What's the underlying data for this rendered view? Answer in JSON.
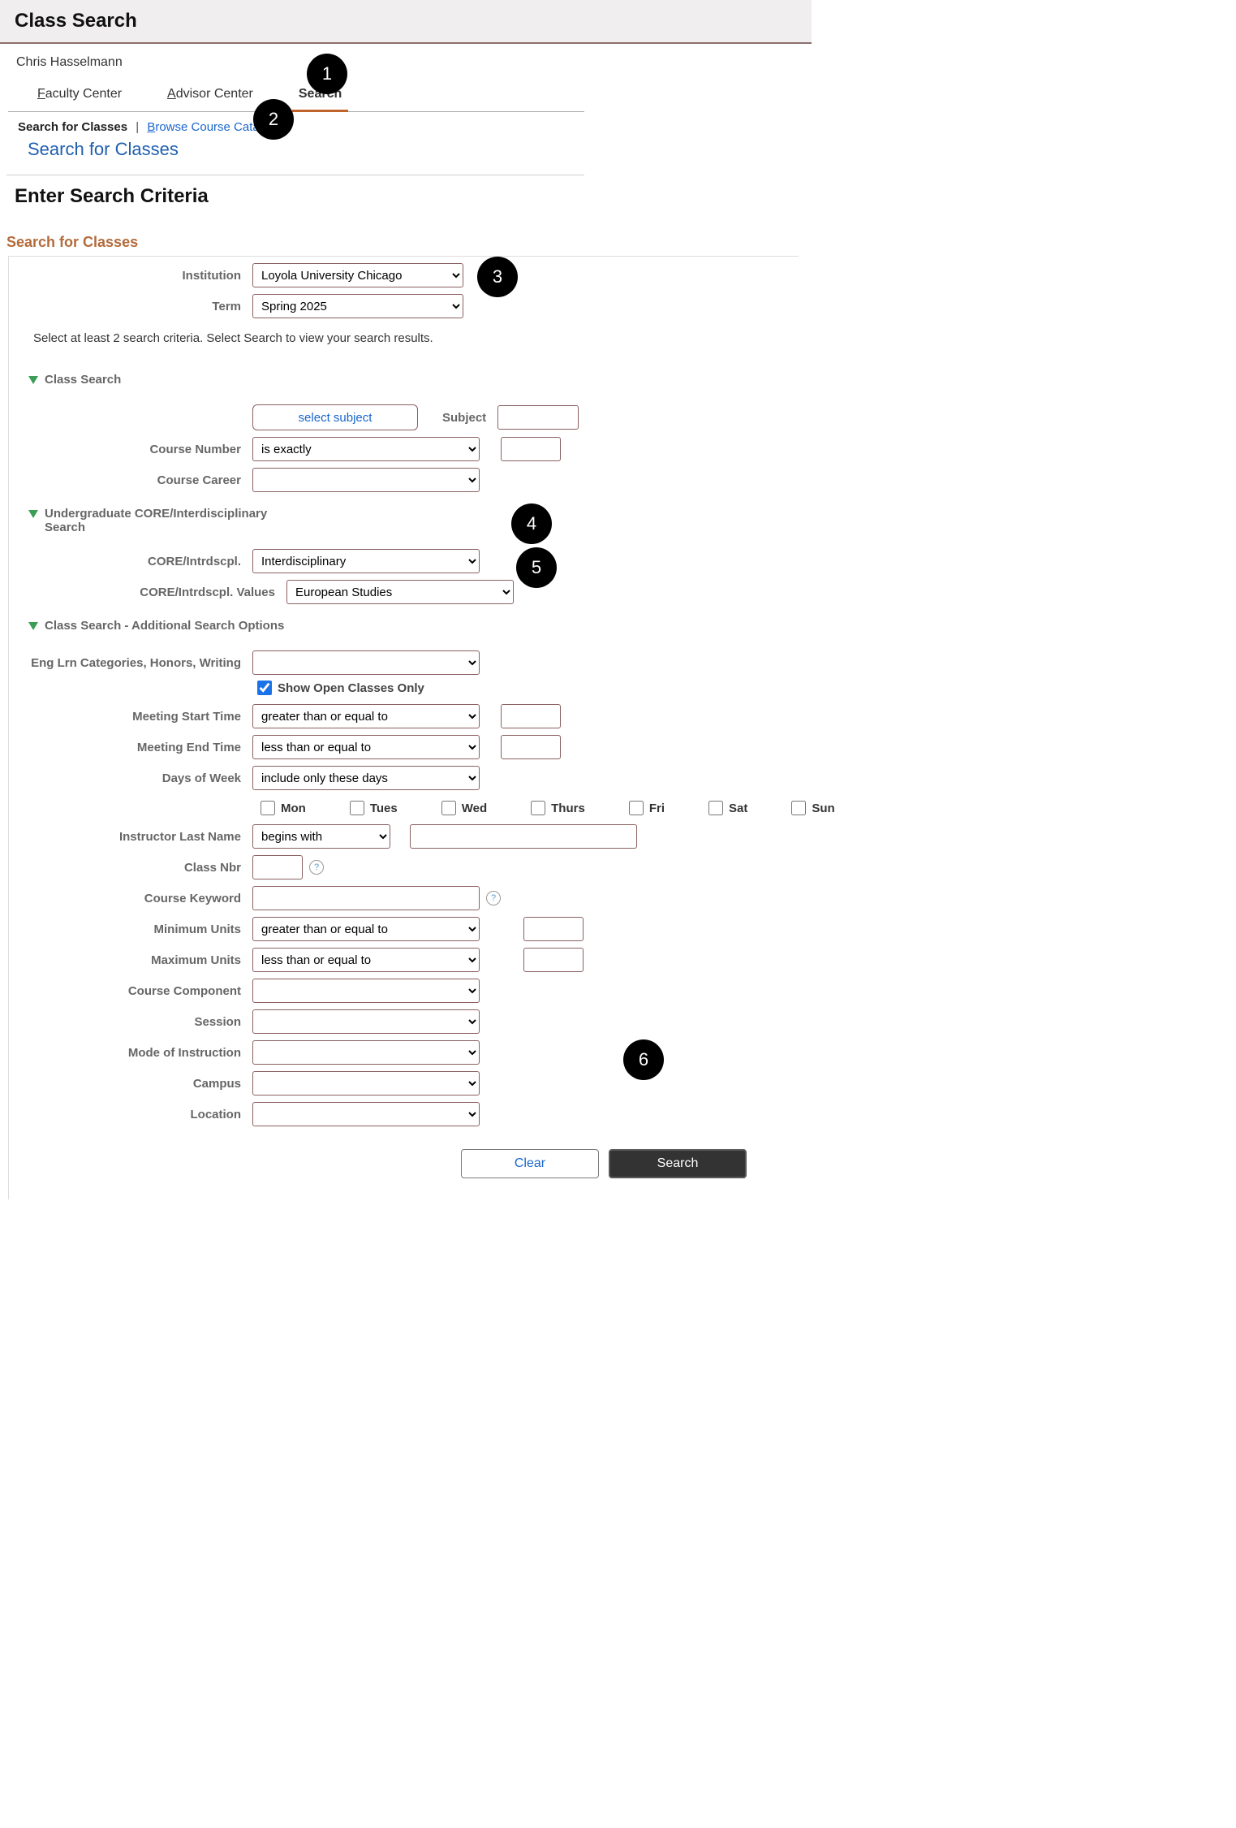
{
  "header": {
    "title": "Class Search"
  },
  "user": {
    "name": "Chris Hasselmann"
  },
  "tabs": {
    "faculty": "Faculty Center",
    "advisor": "Advisor Center",
    "search": "Search"
  },
  "subnav": {
    "search_classes": "Search for Classes",
    "browse_catalog": "Browse Course Catalog"
  },
  "page_title": "Search for Classes",
  "enter_criteria": "Enter Search Criteria",
  "form_heading": "Search for Classes",
  "fields": {
    "institution_label": "Institution",
    "institution_value": "Loyola University Chicago",
    "term_label": "Term",
    "term_value": "Spring 2025",
    "instruction": "Select at least 2 search criteria. Select Search to view your search results."
  },
  "class_search": {
    "heading": "Class Search",
    "select_subject_btn": "select subject",
    "subject_label": "Subject",
    "course_number_label": "Course Number",
    "course_number_op": "is exactly",
    "course_career_label": "Course Career"
  },
  "core": {
    "heading": "Undergraduate CORE/Interdisciplinary\nSearch",
    "field_label": "CORE/Intrdscpl.",
    "field_value": "Interdisciplinary",
    "values_label": "CORE/Intrdscpl. Values",
    "values_value": "European Studies"
  },
  "additional": {
    "heading": "Class Search - Additional Search Options",
    "eng_label": "Eng Lrn Categories, Honors, Writing",
    "show_open": "Show Open Classes Only",
    "start_label": "Meeting Start Time",
    "start_op": "greater than or equal to",
    "end_label": "Meeting End Time",
    "end_op": "less than or equal to",
    "days_label": "Days of Week",
    "days_op": "include only these days",
    "days": {
      "mon": "Mon",
      "tues": "Tues",
      "wed": "Wed",
      "thurs": "Thurs",
      "fri": "Fri",
      "sat": "Sat",
      "sun": "Sun"
    },
    "instructor_label": "Instructor Last Name",
    "instructor_op": "begins with",
    "class_nbr_label": "Class Nbr",
    "keyword_label": "Course Keyword",
    "min_label": "Minimum Units",
    "min_op": "greater than or equal to",
    "max_label": "Maximum Units",
    "max_op": "less than or equal to",
    "component_label": "Course Component",
    "session_label": "Session",
    "mode_label": "Mode of Instruction",
    "campus_label": "Campus",
    "location_label": "Location"
  },
  "buttons": {
    "clear": "Clear",
    "search": "Search"
  },
  "badges": {
    "b1": "1",
    "b2": "2",
    "b3": "3",
    "b4": "4",
    "b5": "5",
    "b6": "6"
  }
}
